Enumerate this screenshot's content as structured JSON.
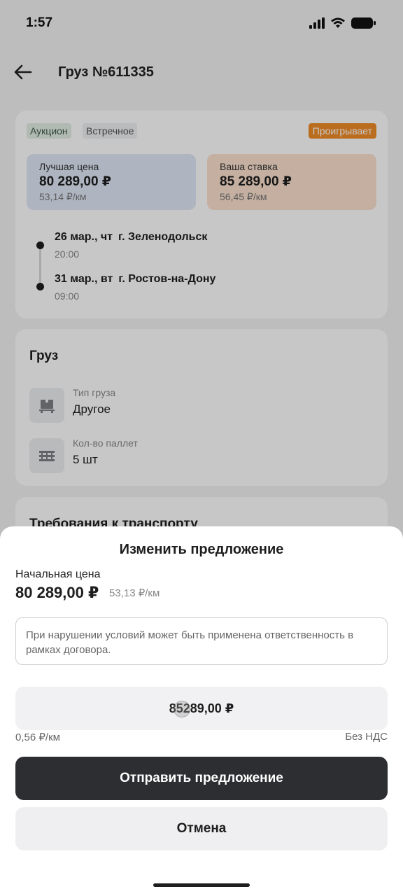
{
  "status_bar": {
    "time": "1:57"
  },
  "header": {
    "title": "Груз №611335"
  },
  "summary": {
    "chips": [
      "Аукцион",
      "Встречное"
    ],
    "status_badge": "Проигрывает",
    "best_price": {
      "label": "Лучшая цена",
      "value": "80 289,00 ₽",
      "per_km": "53,14 ₽/км"
    },
    "your_bid": {
      "label": "Ваша ставка",
      "value": "85 289,00 ₽",
      "per_km": "56,45 ₽/км"
    },
    "route": [
      {
        "date": "26 мар., чт",
        "city": "г. Зеленодольск",
        "time": "20:00"
      },
      {
        "date": "31 мар., вт",
        "city": "г. Ростов-на-Дону",
        "time": "09:00"
      }
    ]
  },
  "cargo": {
    "title": "Груз",
    "items": [
      {
        "label": "Тип груза",
        "value": "Другое"
      },
      {
        "label": "Кол-во паллет",
        "value": "5 шт"
      }
    ]
  },
  "transport": {
    "title": "Требования к транспорту"
  },
  "sheet": {
    "title": "Изменить предложение",
    "start_price_label": "Начальная цена",
    "start_price": "80 289,00 ₽",
    "start_per_km": "53,13 ₽/км",
    "notice": "При нарушении условий может быть применена ответственность в рамках договора.",
    "bid_value": "85289,00 ₽",
    "per_km": "0,56 ₽/км",
    "vat": "Без НДС",
    "submit_label": "Отправить предложение",
    "cancel_label": "Отмена"
  },
  "colors": {
    "badge_orange": "#f08c28",
    "primary_button": "#2c2e31"
  }
}
